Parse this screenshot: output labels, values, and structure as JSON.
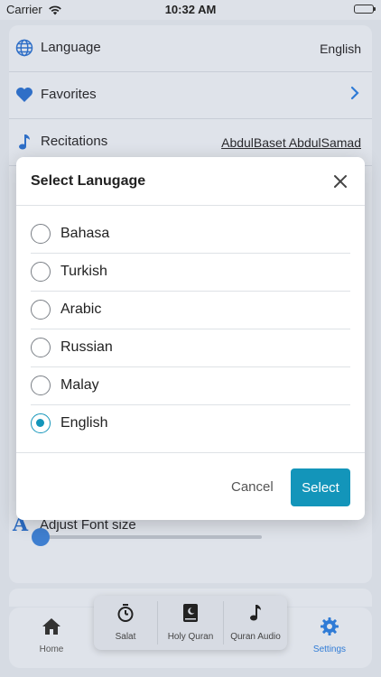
{
  "status_bar": {
    "carrier": "Carrier",
    "time": "10:32 AM"
  },
  "settings": {
    "rows": [
      {
        "label": "Language",
        "value": "English",
        "icon": "globe-icon"
      },
      {
        "label": "Favorites",
        "icon": "heart-icon",
        "action": "chevron-right-icon"
      },
      {
        "label": "Recitations",
        "value": "AbdulBaset AbdulSamad",
        "icon": "music-note-icon"
      }
    ],
    "font_size": {
      "label": "Adjust Font size",
      "icon_glyph": "A",
      "level": 0.0
    }
  },
  "modal": {
    "title": "Select Lanugage",
    "options": [
      {
        "label": "Bahasa",
        "selected": false
      },
      {
        "label": "Turkish",
        "selected": false
      },
      {
        "label": "Arabic",
        "selected": false
      },
      {
        "label": "Russian",
        "selected": false
      },
      {
        "label": "Malay",
        "selected": false
      },
      {
        "label": "English",
        "selected": true
      }
    ],
    "cancel_label": "Cancel",
    "select_label": "Select",
    "accent_color": "#1395ba"
  },
  "tabbar": {
    "home": {
      "label": "Home",
      "icon": "home-icon"
    },
    "salat": {
      "label": "Salat",
      "icon": "stopwatch-icon"
    },
    "holy_quran": {
      "label": "Holy Quran",
      "icon": "book-icon"
    },
    "quran_audio": {
      "label": "Quran Audio",
      "icon": "music-note-icon"
    },
    "settings": {
      "label": "Settings",
      "icon": "gear-icon",
      "active": true
    },
    "active_color": "#2f7bd6"
  }
}
